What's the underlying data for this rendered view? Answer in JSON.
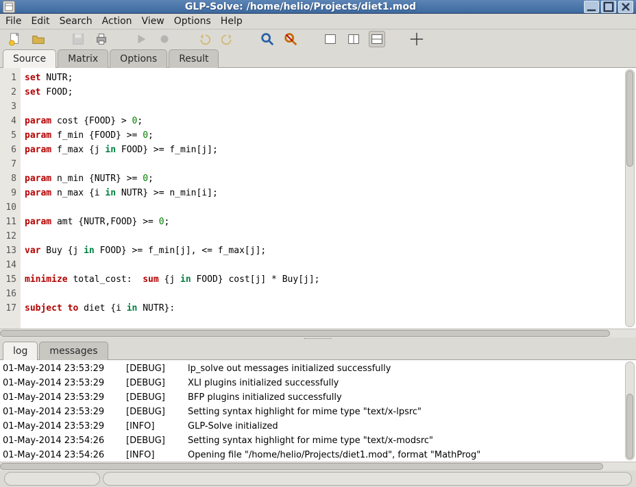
{
  "window": {
    "title": "GLP-Solve: /home/helio/Projects/diet1.mod"
  },
  "menu": {
    "file": "File",
    "edit": "Edit",
    "search": "Search",
    "action": "Action",
    "view": "View",
    "options": "Options",
    "help": "Help"
  },
  "toolbar_icons": {
    "new": "new-file-icon",
    "open": "open-file-icon",
    "save": "save-icon",
    "print": "print-icon",
    "run": "run-icon",
    "record": "record-icon",
    "undo": "undo-icon",
    "redo": "redo-icon",
    "find": "find-icon",
    "find_replace": "find-replace-icon",
    "panel1": "panel-left-icon",
    "panel2": "panel-right-icon",
    "panel3": "panel-both-icon",
    "crosshair": "crosshair-icon"
  },
  "editor_tabs": {
    "source": "Source",
    "matrix": "Matrix",
    "options": "Options",
    "result": "Result"
  },
  "code": [
    {
      "n": 1,
      "tokens": [
        [
          "kw-set",
          "set"
        ],
        [
          "",
          " NUTR;"
        ]
      ]
    },
    {
      "n": 2,
      "tokens": [
        [
          "kw-set",
          "set"
        ],
        [
          "",
          " FOOD;"
        ]
      ]
    },
    {
      "n": 3,
      "tokens": []
    },
    {
      "n": 4,
      "tokens": [
        [
          "kw-param",
          "param"
        ],
        [
          "",
          " cost {FOOD} > "
        ],
        [
          "num",
          "0"
        ],
        [
          "",
          ";"
        ]
      ]
    },
    {
      "n": 5,
      "tokens": [
        [
          "kw-param",
          "param"
        ],
        [
          "",
          " f_min {FOOD} >= "
        ],
        [
          "num",
          "0"
        ],
        [
          "",
          ";"
        ]
      ]
    },
    {
      "n": 6,
      "tokens": [
        [
          "kw-param",
          "param"
        ],
        [
          "",
          " f_max {j "
        ],
        [
          "kw-in",
          "in"
        ],
        [
          "",
          " FOOD} >= f_min[j];"
        ]
      ]
    },
    {
      "n": 7,
      "tokens": []
    },
    {
      "n": 8,
      "tokens": [
        [
          "kw-param",
          "param"
        ],
        [
          "",
          " n_min {NUTR} >= "
        ],
        [
          "num",
          "0"
        ],
        [
          "",
          ";"
        ]
      ]
    },
    {
      "n": 9,
      "tokens": [
        [
          "kw-param",
          "param"
        ],
        [
          "",
          " n_max {i "
        ],
        [
          "kw-in",
          "in"
        ],
        [
          "",
          " NUTR} >= n_min[i];"
        ]
      ]
    },
    {
      "n": 10,
      "tokens": []
    },
    {
      "n": 11,
      "tokens": [
        [
          "kw-param",
          "param"
        ],
        [
          "",
          " amt {NUTR,FOOD} >= "
        ],
        [
          "num",
          "0"
        ],
        [
          "",
          ";"
        ]
      ]
    },
    {
      "n": 12,
      "tokens": []
    },
    {
      "n": 13,
      "tokens": [
        [
          "kw-var",
          "var"
        ],
        [
          "",
          " Buy {j "
        ],
        [
          "kw-in",
          "in"
        ],
        [
          "",
          " FOOD} >= f_min[j], <= f_max[j];"
        ]
      ]
    },
    {
      "n": 14,
      "tokens": []
    },
    {
      "n": 15,
      "tokens": [
        [
          "kw-minimize",
          "minimize"
        ],
        [
          "",
          " total_cost:  "
        ],
        [
          "kw-sum",
          "sum"
        ],
        [
          "",
          " {j "
        ],
        [
          "kw-in",
          "in"
        ],
        [
          "",
          " FOOD} cost[j] * Buy[j];"
        ]
      ]
    },
    {
      "n": 16,
      "tokens": []
    },
    {
      "n": 17,
      "tokens": [
        [
          "kw-subject",
          "subject to"
        ],
        [
          "",
          " diet {i "
        ],
        [
          "kw-in",
          "in"
        ],
        [
          "",
          " NUTR}:"
        ]
      ]
    }
  ],
  "bottom_tabs": {
    "log": "log",
    "messages": "messages"
  },
  "log": [
    {
      "ts": "01-May-2014  23:53:29",
      "lvl": "[DEBUG]",
      "msg": "lp_solve out messages initialized successfully"
    },
    {
      "ts": "01-May-2014  23:53:29",
      "lvl": "[DEBUG]",
      "msg": "XLI plugins initialized successfully"
    },
    {
      "ts": "01-May-2014  23:53:29",
      "lvl": "[DEBUG]",
      "msg": "BFP plugins initialized successfully"
    },
    {
      "ts": "01-May-2014  23:53:29",
      "lvl": "[DEBUG]",
      "msg": "Setting syntax highlight for mime type \"text/x-lpsrc\""
    },
    {
      "ts": "01-May-2014  23:53:29",
      "lvl": "[INFO]",
      "msg": "GLP-Solve initialized"
    },
    {
      "ts": "01-May-2014  23:54:26",
      "lvl": "[DEBUG]",
      "msg": "Setting syntax highlight for mime type \"text/x-modsrc\""
    },
    {
      "ts": "01-May-2014  23:54:26",
      "lvl": "[INFO]",
      "msg": "Opening file \"/home/helio/Projects/diet1.mod\", format \"MathProg\""
    }
  ]
}
